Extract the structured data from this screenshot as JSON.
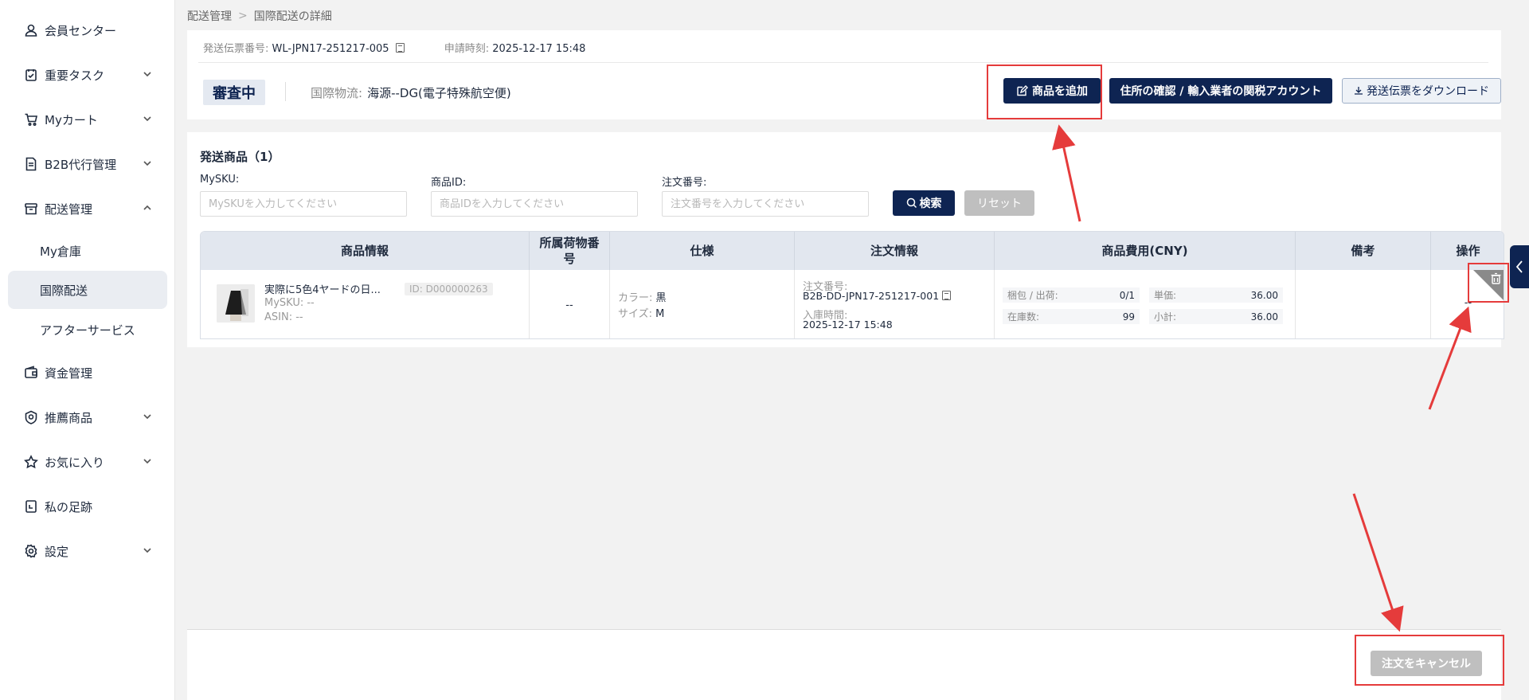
{
  "sidebar": {
    "items": [
      {
        "label": "会員センター",
        "icon": "user-icon",
        "chevron": false
      },
      {
        "label": "重要タスク",
        "icon": "task-icon",
        "chevron": true
      },
      {
        "label": "Myカート",
        "icon": "cart-icon",
        "chevron": true
      },
      {
        "label": "B2B代行管理",
        "icon": "document-icon",
        "chevron": true
      },
      {
        "label": "配送管理",
        "icon": "box-icon",
        "chevron": true,
        "expanded": true
      }
    ],
    "subitems": [
      {
        "label": "My倉庫"
      },
      {
        "label": "国際配送",
        "active": true
      },
      {
        "label": "アフターサービス"
      }
    ],
    "items2": [
      {
        "label": "資金管理",
        "icon": "wallet-icon",
        "chevron": false
      },
      {
        "label": "推薦商品",
        "icon": "badge-icon",
        "chevron": true
      },
      {
        "label": "お気に入り",
        "icon": "star-icon",
        "chevron": true
      },
      {
        "label": "私の足跡",
        "icon": "history-icon",
        "chevron": false
      },
      {
        "label": "設定",
        "icon": "gear-icon",
        "chevron": true
      }
    ]
  },
  "breadcrumb": {
    "parent": "配送管理",
    "sep": ">",
    "current": "国際配送の詳細"
  },
  "header": {
    "invoice_label": "発送伝票番号:",
    "invoice_no": "WL-JPN17-251217-005",
    "applied_label": "申請時刻:",
    "applied_time": "2025-12-17 15:48",
    "status": "審査中",
    "logistics_label": "国際物流:",
    "logistics_value": "海源--DG(電子特殊航空便)",
    "add_product": "商品を追加",
    "address_confirm": "住所の確認 / 輸入業者の関税アカウント",
    "download": "発送伝票をダウンロード"
  },
  "products": {
    "title": "発送商品（1）",
    "filters": {
      "mysku_label": "MySKU:",
      "mysku_placeholder": "MySKUを入力してください",
      "productid_label": "商品ID:",
      "productid_placeholder": "商品IDを入力してください",
      "order_label": "注文番号:",
      "order_placeholder": "注文番号を入力してください",
      "search": "検索",
      "reset": "リセット"
    },
    "columns": [
      "商品情報",
      "所属荷物番号",
      "仕様",
      "注文情報",
      "商品費用(CNY)",
      "備考",
      "操作"
    ],
    "row": {
      "name": "実際に5色4ヤードの日...",
      "id": "ID: D000000263",
      "mysku": "MySKU: --",
      "asin": "ASIN: --",
      "package_no": "--",
      "color_label": "カラー:",
      "color": "黒",
      "size_label": "サイズ:",
      "size": "M",
      "order_label": "注文番号:",
      "order_no": "B2B-DD-JPN17-251217-001",
      "inbound_label": "入庫時間:",
      "inbound_time": "2025-12-17 15:48",
      "pack_label": "梱包 / 出荷:",
      "pack_value": "0/1",
      "unit_label": "単価:",
      "unit_value": "36.00",
      "stock_label": "在庫数:",
      "stock_value": "99",
      "subtotal_label": "小計:",
      "subtotal_value": "36.00",
      "remark": "",
      "operation": "--"
    }
  },
  "footer": {
    "cancel": "注文をキャンセル"
  },
  "colors": {
    "primary": "#0e2452",
    "highlight": "#e53b3b",
    "active_bg": "#eaedf2"
  }
}
